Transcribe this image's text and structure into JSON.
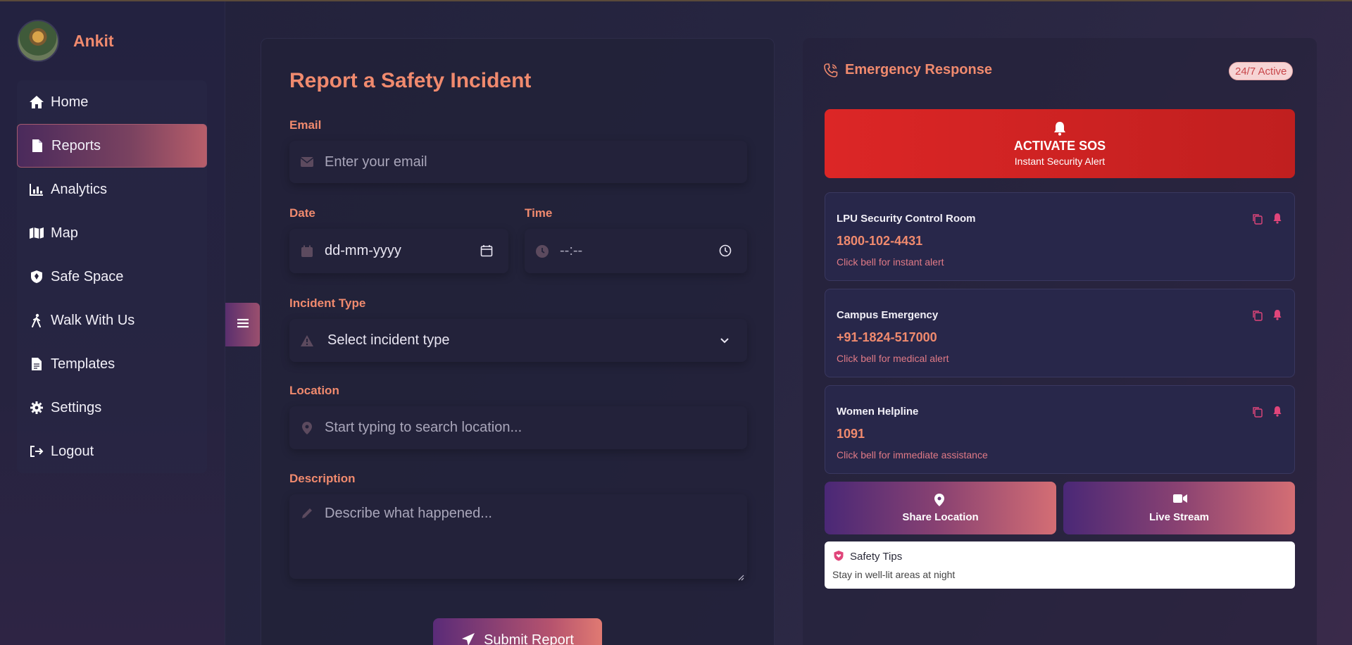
{
  "user": {
    "name": "Ankit"
  },
  "nav": {
    "items": [
      {
        "label": "Home",
        "icon": "home-icon"
      },
      {
        "label": "Reports",
        "icon": "file-icon",
        "active": true
      },
      {
        "label": "Analytics",
        "icon": "chart-icon"
      },
      {
        "label": "Map",
        "icon": "map-icon"
      },
      {
        "label": "Safe Space",
        "icon": "shield-icon"
      },
      {
        "label": "Walk With Us",
        "icon": "walking-icon"
      },
      {
        "label": "Templates",
        "icon": "file-icon"
      },
      {
        "label": "Settings",
        "icon": "gear-icon"
      },
      {
        "label": "Logout",
        "icon": "logout-icon"
      }
    ]
  },
  "form": {
    "title": "Report a Safety Incident",
    "email_label": "Email",
    "email_placeholder": "Enter your email",
    "date_label": "Date",
    "date_value": "dd-mm-yyyy",
    "time_label": "Time",
    "time_value": "--:--",
    "incident_label": "Incident Type",
    "incident_value": "Select incident type",
    "location_label": "Location",
    "location_placeholder": "Start typing to search location...",
    "description_label": "Description",
    "description_placeholder": "Describe what happened...",
    "submit_label": "Submit Report"
  },
  "emergency": {
    "title": "Emergency Response",
    "badge": "24/7 Active",
    "sos_title": "ACTIVATE SOS",
    "sos_subtitle": "Instant Security Alert",
    "contacts": [
      {
        "name": "LPU Security Control Room",
        "number": "1800-102-4431",
        "note": "Click bell for instant alert"
      },
      {
        "name": "Campus Emergency",
        "number": "+91-1824-517000",
        "note": "Click bell for medical alert"
      },
      {
        "name": "Women Helpline",
        "number": "1091",
        "note": "Click bell for immediate assistance"
      }
    ],
    "share_location": "Share Location",
    "live_stream": "Live Stream",
    "tips_title": "Safety Tips",
    "tips_text": "Stay in well-lit areas at night"
  },
  "colors": {
    "accent": "#f08a6e",
    "sos": "#dc2626",
    "bell": "#e0457a"
  }
}
